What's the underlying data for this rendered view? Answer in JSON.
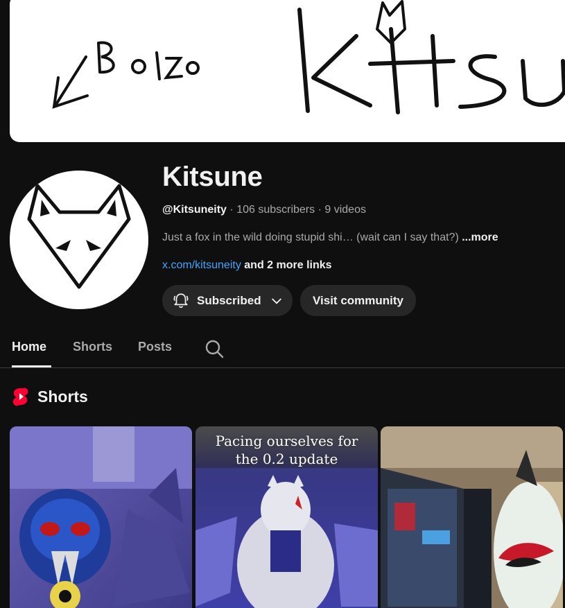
{
  "banner": {
    "scribble_text": "Bozo",
    "title_text": "Kitsune",
    "background": "#ffffff"
  },
  "channel": {
    "name": "Kitsune",
    "handle": "@Kitsuneity",
    "subscribers": "106 subscribers",
    "videos": "9 videos",
    "separator": "·",
    "description": "Just a fox in the wild doing stupid shi… (wait can I say that?)",
    "more_label": "...more",
    "link_text": "x.com/kitsuneity",
    "extra_links": "and 2 more links"
  },
  "actions": {
    "subscribed_label": "Subscribed",
    "visit_community_label": "Visit community"
  },
  "tabs": [
    {
      "label": "Home",
      "active": true
    },
    {
      "label": "Shorts",
      "active": false
    },
    {
      "label": "Posts",
      "active": false
    }
  ],
  "shorts_section": {
    "title": "Shorts",
    "items": [
      {
        "caption": ""
      },
      {
        "caption": "Pacing ourselves for the 0.2 update"
      },
      {
        "caption": ""
      }
    ]
  },
  "icons": {
    "search": "search-icon",
    "bell": "bell-icon",
    "chevron": "chevron-down-icon",
    "shorts": "shorts-logo-icon"
  },
  "colors": {
    "background": "#0f0f0f",
    "text": "#f1f1f1",
    "secondary": "#aaaaaa",
    "link": "#3ea6ff",
    "button": "#272727",
    "shorts_red": "#ff0033"
  }
}
